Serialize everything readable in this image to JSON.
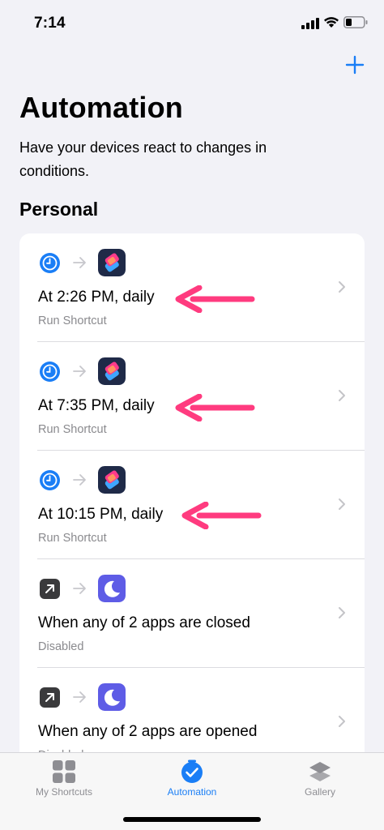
{
  "status_bar": {
    "time": "7:14"
  },
  "header": {
    "title": "Automation",
    "subtitle": "Have your devices react to changes in conditions."
  },
  "section": {
    "title": "Personal"
  },
  "automations": [
    {
      "title": "At 2:26 PM, daily",
      "subtitle": "Run Shortcut",
      "trigger_icon": "clock-icon",
      "action_icon": "shortcuts-app-icon",
      "highlighted": true
    },
    {
      "title": "At 7:35 PM, daily",
      "subtitle": "Run Shortcut",
      "trigger_icon": "clock-icon",
      "action_icon": "shortcuts-app-icon",
      "highlighted": true
    },
    {
      "title": "At 10:15 PM, daily",
      "subtitle": "Run Shortcut",
      "trigger_icon": "clock-icon",
      "action_icon": "shortcuts-app-icon",
      "highlighted": true
    },
    {
      "title": "When any of 2 apps are closed",
      "subtitle": "Disabled",
      "trigger_icon": "app-arrow-icon",
      "action_icon": "focus-moon-icon",
      "highlighted": false
    },
    {
      "title": "When any of 2 apps are opened",
      "subtitle": "Disabled",
      "trigger_icon": "app-arrow-icon",
      "action_icon": "focus-moon-icon",
      "highlighted": false
    }
  ],
  "tab_bar": {
    "tabs": [
      {
        "label": "My Shortcuts",
        "icon": "grid-icon",
        "active": false
      },
      {
        "label": "Automation",
        "icon": "automation-check-icon",
        "active": true
      },
      {
        "label": "Gallery",
        "icon": "layers-icon",
        "active": false
      }
    ]
  },
  "colors": {
    "accent": "#1a7ef6",
    "annotation_arrow": "#ff3b7f",
    "focus_purple": "#5e5ce6",
    "background": "#f2f2f7"
  }
}
